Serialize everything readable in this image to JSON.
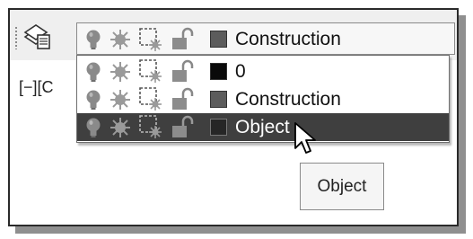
{
  "canvas": {
    "viewport_label": "[−][C"
  },
  "toolbar": {
    "layer_combo": {
      "current": "Construction",
      "current_color": "#5c5c5c",
      "icons": [
        "lightbulb-on-icon",
        "sun-freeze-icon",
        "viewport-freeze-icon",
        "unlocked-padlock-icon"
      ]
    }
  },
  "layer_dropdown": {
    "items": [
      {
        "name": "0",
        "color": "#0a0a0a",
        "highlighted": false
      },
      {
        "name": "Construction",
        "color": "#5c5c5c",
        "highlighted": false
      },
      {
        "name": "Object",
        "color": "#262626",
        "highlighted": true
      }
    ]
  },
  "tooltip": {
    "text": "Object"
  }
}
